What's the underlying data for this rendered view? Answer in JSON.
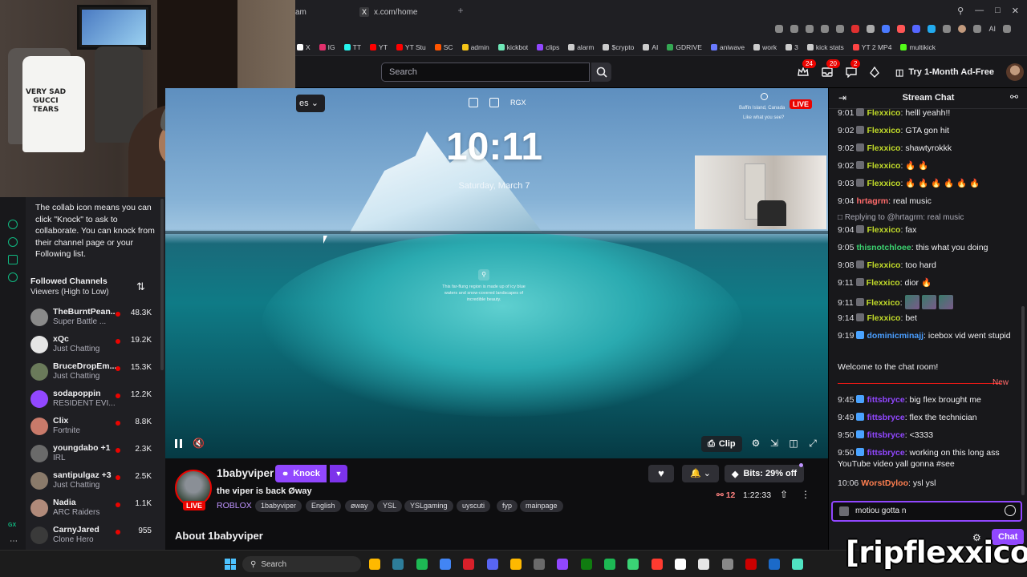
{
  "browser": {
    "tabs": [
      {
        "label": "am"
      },
      {
        "label": "x.com/home",
        "icon": "x-icon"
      }
    ],
    "new_tab": "+",
    "ai_label": "AI",
    "bookmarks": [
      "X",
      "IG",
      "TT",
      "YT",
      "YT Stu",
      "SC",
      "admin",
      "kickbot",
      "clips",
      "alarm",
      "$crypto",
      "AI",
      "GDRIVE",
      "aniwave",
      "work",
      "3",
      "kick stats",
      "YT 2 MP4",
      "multikick"
    ]
  },
  "twitch_nav": {
    "search_placeholder": "Search",
    "badges": {
      "inbox": "24",
      "notifications": "20",
      "whispers": "2"
    },
    "prime_label": "Try 1-Month Ad-Free"
  },
  "webcam": {
    "shirt_text": "VERY SAD\nGUCCI TEARS"
  },
  "sidebar": {
    "collab_text": "The collab icon means you can click \"Knock\" to ask to collaborate. You can knock from their channel page or your Following list.",
    "followed_title": "Followed Channels",
    "followed_sort": "Viewers (High to Low)",
    "rail_label": "GX",
    "channels": [
      {
        "name": "TheBurntPean...",
        "game": "Super Battle ...",
        "viewers": "48.3K",
        "color": "#8a8a8a"
      },
      {
        "name": "xQc",
        "game": "Just Chatting",
        "viewers": "19.2K",
        "color": "#e5e5e5"
      },
      {
        "name": "BruceDropEm...",
        "game": "Just Chatting",
        "viewers": "15.3K",
        "color": "#6a7a5a"
      },
      {
        "name": "sodapoppin",
        "game": "RESIDENT EVI...",
        "viewers": "12.2K",
        "color": "#9147ff"
      },
      {
        "name": "Clix",
        "game": "Fortnite",
        "viewers": "8.8K",
        "color": "#c97a6a"
      },
      {
        "name": "youngdabo +1",
        "game": "IRL",
        "viewers": "2.3K",
        "color": "#6a6a6a"
      },
      {
        "name": "santipulgaz +3",
        "game": "Just Chatting",
        "viewers": "2.5K",
        "color": "#8a7a6a"
      },
      {
        "name": "Nadia",
        "game": "ARC Raiders",
        "viewers": "1.1K",
        "color": "#b08a7a"
      },
      {
        "name": "CarnyJared",
        "game": "Clone Hero",
        "viewers": "955",
        "color": "#3a3a3a"
      }
    ]
  },
  "video": {
    "theater_label": "es",
    "top_label": "RGX",
    "clock": "10:11",
    "date": "Saturday, March 7",
    "spot_title": "Baffin Island, Canada",
    "spot_sub": "Like what you see?",
    "live": "LIVE",
    "caption": "This far-flung region is made up of icy blue waters and snow-covered landscapes of incredible beauty.",
    "clip_label": "Clip"
  },
  "stream": {
    "name": "1babyviper",
    "knock_label": "Knock",
    "title": "the viper is back Øway",
    "game": "ROBLOX",
    "live": "LIVE",
    "tags": [
      "1babyviper",
      "English",
      "øway",
      "YSL",
      "YSLgaming",
      "uyscuti",
      "fyp",
      "mainpage"
    ],
    "bits_label": "Bits: 29% off",
    "viewers": "12",
    "uptime": "1:22:33",
    "about": "About 1babyviper"
  },
  "chat": {
    "title": "Stream Chat",
    "messages": [
      {
        "ts": "9:01",
        "badge": "grey",
        "user": "Flexxico",
        "color": "#c2db2a",
        "text": "helll yeahh!!"
      },
      {
        "ts": "9:02",
        "badge": "grey",
        "user": "Flexxico",
        "color": "#c2db2a",
        "text": "GTA gon hit"
      },
      {
        "ts": "9:02",
        "badge": "grey",
        "user": "Flexxico",
        "color": "#c2db2a",
        "text": "shawtyrokkk"
      },
      {
        "ts": "9:02",
        "badge": "grey",
        "user": "Flexxico",
        "color": "#c2db2a",
        "text": "🔥 🔥"
      },
      {
        "ts": "9:03",
        "badge": "grey",
        "user": "Flexxico",
        "color": "#c2db2a",
        "text": "🔥 🔥 🔥 🔥 🔥 🔥"
      },
      {
        "ts": "9:04",
        "badge": "",
        "user": "hrtagrm",
        "color": "#ff6b6b",
        "text": "real music"
      },
      {
        "ts": "9:04",
        "badge": "grey",
        "user": "Flexxico",
        "color": "#c2db2a",
        "text": "fax"
      },
      {
        "ts": "9:05",
        "badge": "",
        "user": "thisnotchloee",
        "color": "#3bd16f",
        "text": "this what you doing"
      },
      {
        "ts": "9:08",
        "badge": "grey",
        "user": "Flexxico",
        "color": "#c2db2a",
        "text": "too hard"
      },
      {
        "ts": "9:11",
        "badge": "grey",
        "user": "Flexxico",
        "color": "#c2db2a",
        "text": "dior 🔥"
      },
      {
        "ts": "9:11",
        "badge": "grey",
        "user": "Flexxico",
        "color": "#c2db2a",
        "text": ""
      },
      {
        "ts": "9:14",
        "badge": "grey",
        "user": "Flexxico",
        "color": "#c2db2a",
        "text": "bet"
      },
      {
        "ts": "9:19",
        "badge": "blue",
        "user": "dominicminajj",
        "color": "#4a9eff",
        "text": "icebox vid went stupid"
      },
      {
        "ts": "9:45",
        "badge": "blue",
        "user": "fittsbryce",
        "color": "#9147ff",
        "text": "big flex brought me"
      },
      {
        "ts": "9:49",
        "badge": "blue",
        "user": "fittsbryce",
        "color": "#9147ff",
        "text": "flex the technician"
      },
      {
        "ts": "9:50",
        "badge": "blue",
        "user": "fittsbryce",
        "color": "#9147ff",
        "text": "<3333"
      },
      {
        "ts": "9:50",
        "badge": "blue",
        "user": "fittsbryce",
        "color": "#9147ff",
        "text": "working on this long ass YouTube video yall gonna #see"
      },
      {
        "ts": "10:06",
        "badge": "",
        "user": "WorstDyloo",
        "color": "#ff7f50",
        "text": "ysl ysl"
      }
    ],
    "reply_to": "Replying to @hrtagrm: real music",
    "welcome": "Welcome to the chat room!",
    "new_label": "New",
    "input_value": "motiou gotta n",
    "chat_button": "Chat"
  },
  "overlay_text": "[ripflexxico]",
  "taskbar": {
    "search": "Search",
    "apps": [
      "#ffb900",
      "#2d7d9a",
      "#1db954",
      "#4285f4",
      "#d8202a",
      "#5865f2",
      "#ffb900",
      "#6a6a6a",
      "#9147ff",
      "#107c10",
      "#1db954",
      "#3ad475",
      "#ff3b30",
      "#ffffff",
      "#e5e5e5",
      "#888888",
      "#cc0000",
      "#1b6ac9",
      "#50e3c2"
    ]
  }
}
